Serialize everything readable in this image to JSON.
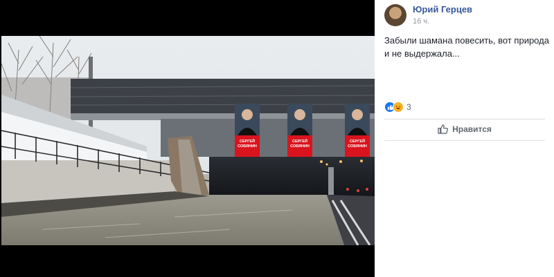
{
  "post": {
    "author": "Юрий Герцев",
    "timestamp": "16 ч.",
    "text": "Забыли шамана повесить, вот природа и не выдержала...",
    "reaction_count": "3",
    "like_label": "Нравится"
  },
  "photo": {
    "billboards": [
      {
        "line1": "СЕРГЕЙ",
        "line2": "СОБЯНИН"
      },
      {
        "line1": "СЕРГЕЙ",
        "line2": "СОБЯНИН"
      },
      {
        "line1": "СЕРГЕЙ",
        "line2": "СОБЯНИН"
      }
    ]
  },
  "icons": {
    "like_reaction": "thumbs-up-icon",
    "haha_reaction": "laughing-face-icon",
    "like_button": "thumbs-up-outline-icon"
  },
  "colors": {
    "author_link": "#385898",
    "like_blue": "#1877f2",
    "haha_yellow": "#f7b125",
    "billboard_red": "#d9141e"
  }
}
